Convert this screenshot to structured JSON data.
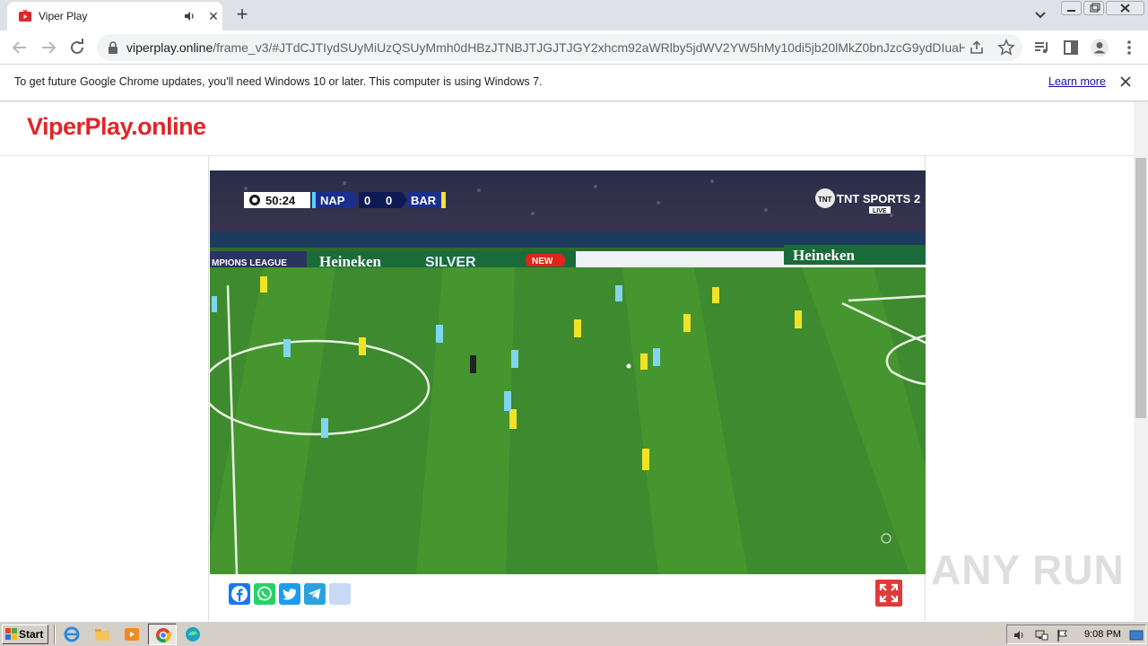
{
  "browser": {
    "tab": {
      "title": "Viper Play"
    },
    "address": {
      "host": "viperplay.online",
      "path": "/frame_v3/#JTdCJTIydSUyMiUzQSUyMmh0dHBzJTNBJTJGJTJGY2xhcm92aWRlby5jdWV2YW5hMy10di5jb20lMkZ0bnJzcG9ydDIuaHR..."
    }
  },
  "infobar": {
    "message": "To get future Google Chrome updates, you'll need Windows 10 or later. This computer is using Windows 7.",
    "link": "Learn more"
  },
  "site": {
    "logo": "ViperPlay.online"
  },
  "video": {
    "clock": "50:24",
    "home": "NAP",
    "home_score": "0",
    "away_score": "0",
    "away": "BAR",
    "broadcaster": "TNT SPORTS 2",
    "live": "LIVE",
    "board_left": "MPIONS LEAGUE",
    "board_brand": "Heineken",
    "board_silver": "SILVER",
    "board_new": "NEW",
    "board_brand2": "Heineken"
  },
  "share": [
    "facebook-icon",
    "whatsapp-icon",
    "twitter-icon",
    "telegram-icon",
    "more-share-icon"
  ],
  "taskbar": {
    "start": "Start",
    "clock": "9:08 PM"
  },
  "watermark": "ANY RUN"
}
